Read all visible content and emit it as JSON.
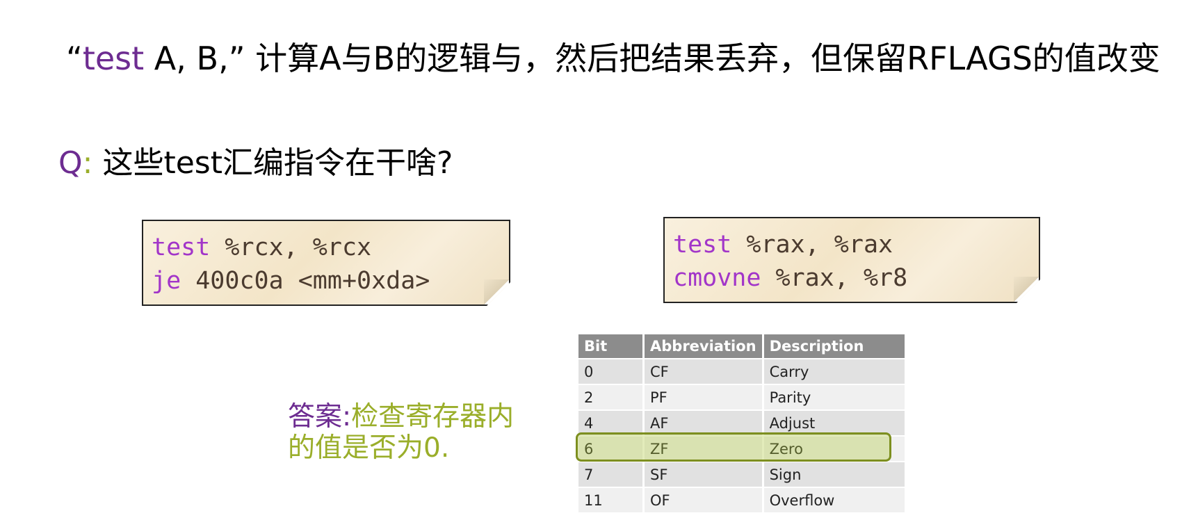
{
  "title": {
    "open_quote": "“",
    "keyword": "test",
    "rest": " A, B,” 计算A与B的逻辑与，然后把结果丢弃，但保留RFLAGS的值改变"
  },
  "question": {
    "label": "Q",
    "colon": ":",
    "text": "这些test汇编指令在干啥?"
  },
  "code_left": {
    "lines": [
      {
        "op": "test",
        "args": " %rcx, %rcx"
      },
      {
        "op": "je",
        "args": " 400c0a <mm+0xda>"
      }
    ]
  },
  "code_right": {
    "lines": [
      {
        "op": "test",
        "args": " %rax, %rax"
      },
      {
        "op": "cmovne",
        "args": " %rax, %r8"
      }
    ]
  },
  "answer": {
    "label": "答案:",
    "line1": "检查寄存器内",
    "line2": "的值是否为0."
  },
  "flags_table": {
    "headers": [
      "Bit",
      "Abbreviation",
      "Description"
    ],
    "rows": [
      [
        "0",
        "CF",
        "Carry"
      ],
      [
        "2",
        "PF",
        "Parity"
      ],
      [
        "4",
        "AF",
        "Adjust"
      ],
      [
        "6",
        "ZF",
        "Zero"
      ],
      [
        "7",
        "SF",
        "Sign"
      ],
      [
        "11",
        "OF",
        "Overflow"
      ]
    ],
    "highlighted_row": 3
  },
  "colors": {
    "keyword_purple": "#6d2c91",
    "code_purple": "#a235c9",
    "answer_green": "#9aae2a",
    "highlight_border": "#7d8f1f"
  }
}
